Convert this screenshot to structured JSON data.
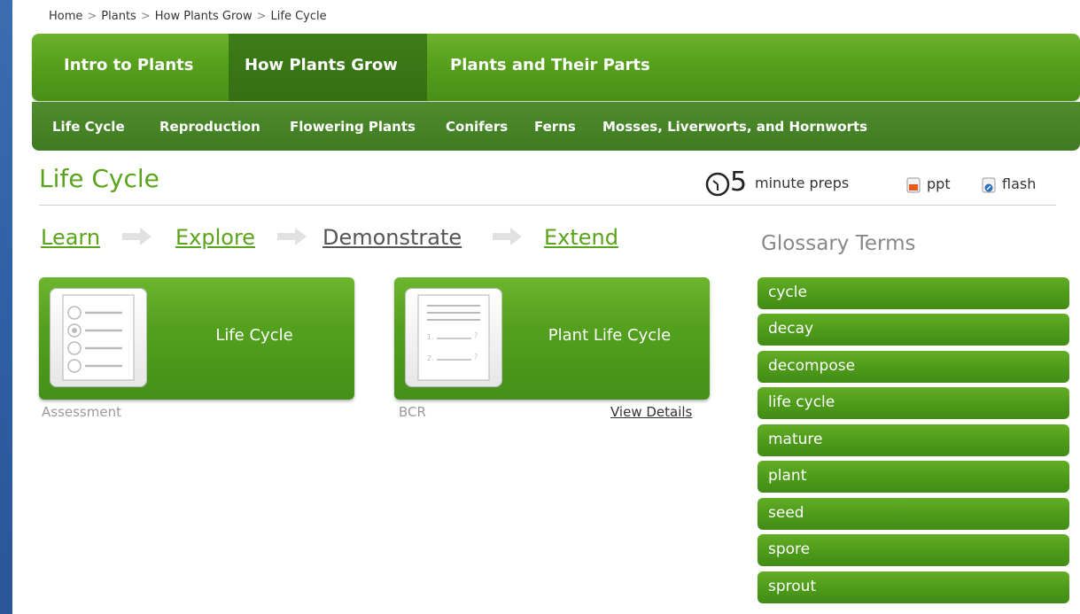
{
  "breadcrumb": [
    "Home",
    "Plants",
    "How Plants Grow",
    "Life Cycle"
  ],
  "breadcrumb_sep": ">",
  "nav": {
    "tabs": [
      "Intro to Plants",
      "How Plants Grow",
      "Plants and Their Parts"
    ],
    "active_tab": "How Plants Grow",
    "subtabs": [
      "Life Cycle",
      "Reproduction",
      "Flowering Plants",
      "Conifers",
      "Ferns",
      "Mosses, Liverworts, and Hornworts"
    ]
  },
  "page": {
    "title": "Life Cycle",
    "preps_number": "5",
    "preps_label": "minute preps",
    "ppt_label": "ppt",
    "flash_label": "flash"
  },
  "steps": [
    {
      "label": "Learn",
      "state": "link"
    },
    {
      "label": "Explore",
      "state": "link"
    },
    {
      "label": "Demonstrate",
      "state": "current"
    },
    {
      "label": "Extend",
      "state": "link"
    }
  ],
  "cards": [
    {
      "title": "Life Cycle",
      "type": "Assessment",
      "thumb_icon": "quiz-icon"
    },
    {
      "title": "Plant Life Cycle",
      "type": "BCR",
      "thumb_icon": "worksheet-icon",
      "action": "View Details"
    }
  ],
  "glossary": {
    "title": "Glossary Terms",
    "terms": [
      "cycle",
      "decay",
      "decompose",
      "life cycle",
      "mature",
      "plant",
      "seed",
      "spore",
      "sprout"
    ]
  },
  "colors": {
    "brand_green": "#5aa41c",
    "nav_dark": "#3f7a22",
    "background_blue": "#2f5fa6"
  }
}
